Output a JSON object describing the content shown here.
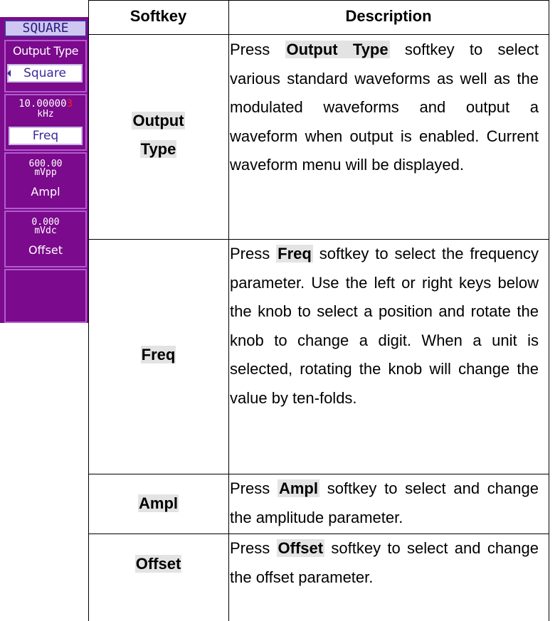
{
  "softkey_panel": {
    "title": "SQUARE",
    "output_type": {
      "label": "Output Type",
      "value": "Square"
    },
    "freq": {
      "value": "10.00000",
      "cursor_digit": "3",
      "unit": "kHz",
      "label": "Freq"
    },
    "ampl": {
      "value": "600.00",
      "unit": "mVpp",
      "label": "Ampl"
    },
    "offset": {
      "value": "0.000",
      "unit": "mVdc",
      "label": "Offset"
    }
  },
  "table": {
    "headers": [
      "Softkey",
      "Description"
    ],
    "rows": [
      {
        "key_line1": "Output",
        "key_line2": "Type",
        "desc_pre": "Press ",
        "desc_key": "Output Type",
        "desc_post": " softkey to select various standard waveforms as well as the modulated waveforms and output a waveform when output is enabled. Current waveform menu will be displayed."
      },
      {
        "key": "Freq",
        "desc_pre": "Press ",
        "desc_key": "Freq",
        "desc_post": " softkey to select the frequency parameter. Use the left or right keys below the knob to select a position and rotate the knob to change a digit. When a unit is selected, rotating the knob will change the value by ten-folds."
      },
      {
        "key": "Ampl",
        "desc_pre": "Press ",
        "desc_key": "Ampl",
        "desc_post": " softkey to select and change the amplitude parameter."
      },
      {
        "key": "Offset",
        "desc_pre": "Press ",
        "desc_key": "Offset",
        "desc_post": " softkey to select and change the offset parameter."
      }
    ]
  },
  "colors": {
    "panel_bg": "#7b0a8c",
    "panel_border": "#b35ccd",
    "header_bg": "#cfc6f2",
    "highlight": "#e3e3e3"
  }
}
